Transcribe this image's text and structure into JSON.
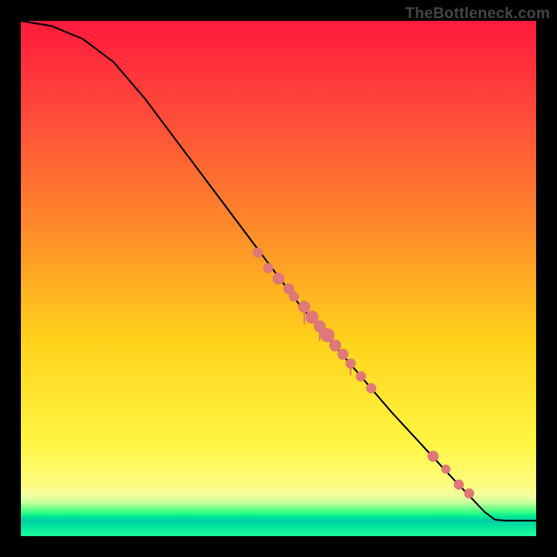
{
  "watermark": "TheBottleneck.com",
  "colors": {
    "background": "#000000",
    "curve": "#000000",
    "point": "#e07878"
  },
  "chart_data": {
    "type": "line",
    "title": "",
    "xlabel": "",
    "ylabel": "",
    "xlim": [
      0,
      100
    ],
    "ylim": [
      0,
      100
    ],
    "curve": [
      {
        "x": 0,
        "y": 100
      },
      {
        "x": 6,
        "y": 99
      },
      {
        "x": 12,
        "y": 96.5
      },
      {
        "x": 18,
        "y": 92
      },
      {
        "x": 24,
        "y": 85
      },
      {
        "x": 30,
        "y": 77
      },
      {
        "x": 36,
        "y": 69
      },
      {
        "x": 42,
        "y": 61
      },
      {
        "x": 48,
        "y": 53
      },
      {
        "x": 54,
        "y": 45
      },
      {
        "x": 60,
        "y": 38
      },
      {
        "x": 66,
        "y": 31
      },
      {
        "x": 72,
        "y": 24
      },
      {
        "x": 78,
        "y": 17.5
      },
      {
        "x": 84,
        "y": 11
      },
      {
        "x": 90,
        "y": 4.7
      },
      {
        "x": 92,
        "y": 3.2
      },
      {
        "x": 94,
        "y": 3.0
      },
      {
        "x": 100,
        "y": 3.0
      }
    ],
    "points": [
      {
        "x": 46,
        "y": 55,
        "r": 1.0
      },
      {
        "x": 48,
        "y": 52,
        "r": 1.0
      },
      {
        "x": 50,
        "y": 50,
        "r": 1.2
      },
      {
        "x": 52,
        "y": 48,
        "r": 1.1
      },
      {
        "x": 53,
        "y": 46.5,
        "r": 1.0
      },
      {
        "x": 55,
        "y": 44.5,
        "r": 1.2,
        "drip": 3
      },
      {
        "x": 56.5,
        "y": 42.5,
        "r": 1.3
      },
      {
        "x": 58,
        "y": 40.7,
        "r": 1.2,
        "drip": 2.5
      },
      {
        "x": 59.5,
        "y": 39,
        "r": 1.4
      },
      {
        "x": 61,
        "y": 37,
        "r": 1.2
      },
      {
        "x": 62.5,
        "y": 35.3,
        "r": 1.1
      },
      {
        "x": 64,
        "y": 33.5,
        "r": 1.0,
        "drip": 2
      },
      {
        "x": 66,
        "y": 31,
        "r": 1.0
      },
      {
        "x": 68,
        "y": 28.7,
        "r": 1.0
      },
      {
        "x": 80,
        "y": 15.5,
        "r": 1.1
      },
      {
        "x": 82.5,
        "y": 13,
        "r": 0.9
      },
      {
        "x": 85,
        "y": 10,
        "r": 1.0
      },
      {
        "x": 87,
        "y": 8.3,
        "r": 1.0
      }
    ]
  }
}
